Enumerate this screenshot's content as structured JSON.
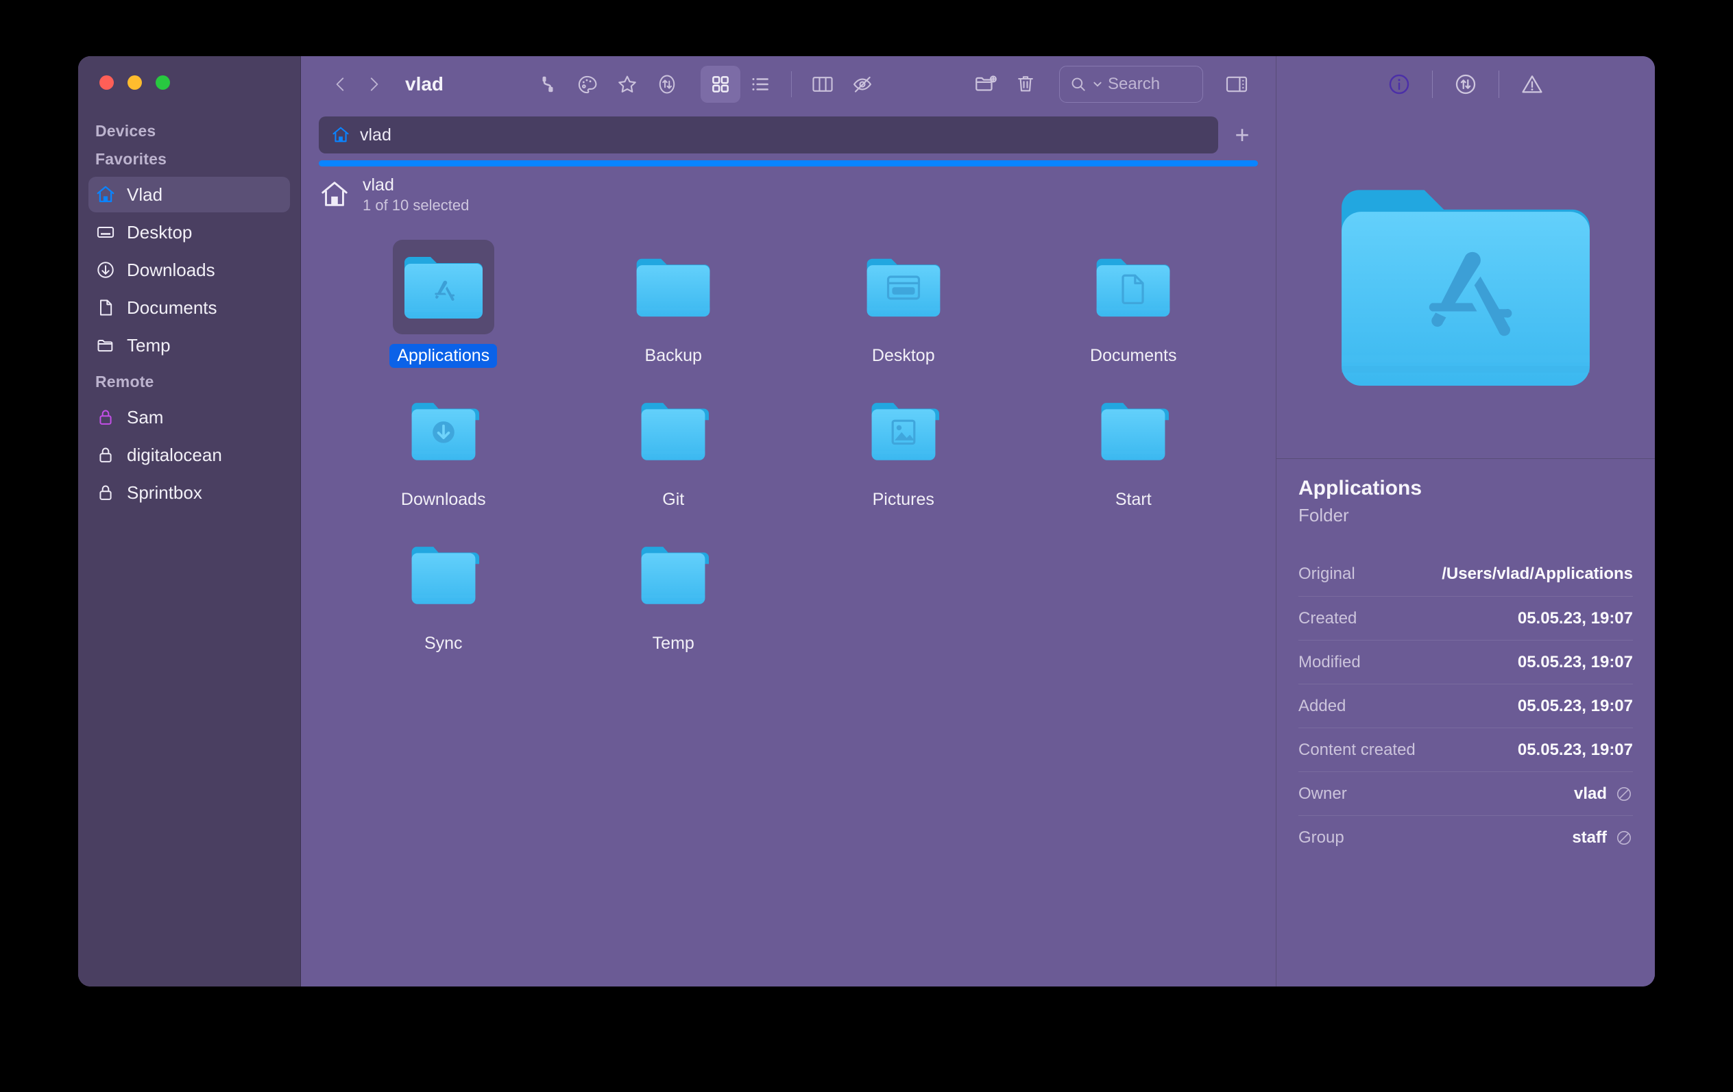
{
  "window": {
    "traffic_lights": [
      "close",
      "minimize",
      "zoom"
    ],
    "colors": {
      "window_bg": "#6B5B95",
      "sidebar_bg": "#4A3F61",
      "accent_blue": "#0A84FF",
      "selection_blue": "#0B62E8",
      "folder_blue": "#4FC3F7",
      "lock_active": "#C44FE8",
      "info_active": "#4B2FA8"
    }
  },
  "sidebar": {
    "sections": [
      {
        "title": "Devices",
        "items": []
      },
      {
        "title": "Favorites",
        "items": [
          {
            "label": "Vlad",
            "icon": "home-icon",
            "selected": true
          },
          {
            "label": "Desktop",
            "icon": "desktop-icon",
            "selected": false
          },
          {
            "label": "Downloads",
            "icon": "download-icon",
            "selected": false
          },
          {
            "label": "Documents",
            "icon": "document-icon",
            "selected": false
          },
          {
            "label": "Temp",
            "icon": "folder-icon",
            "selected": false
          }
        ]
      },
      {
        "title": "Remote",
        "items": [
          {
            "label": "Sam",
            "icon": "lock-icon",
            "selected": false
          },
          {
            "label": "digitalocean",
            "icon": "lock-icon",
            "selected": false
          },
          {
            "label": "Sprintbox",
            "icon": "lock-icon",
            "selected": false
          }
        ]
      }
    ]
  },
  "toolbar": {
    "back": "back-arrow",
    "forward": "forward-arrow",
    "breadcrumb": "vlad",
    "buttons": [
      {
        "name": "connection-icon",
        "active": false
      },
      {
        "name": "palette-icon",
        "active": false
      },
      {
        "name": "star-icon",
        "active": false
      },
      {
        "name": "sort-icon",
        "active": false
      }
    ],
    "view_modes": [
      {
        "name": "grid-view",
        "active": true
      },
      {
        "name": "list-view",
        "active": false
      },
      {
        "name": "column-view",
        "active": false
      }
    ],
    "hidden_files": "eye-slash-icon",
    "new_folder": "new-folder-icon",
    "trash": "trash-icon",
    "sidebar_toggle": "inspector-toggle-icon"
  },
  "search": {
    "placeholder": "Search",
    "value": "",
    "icon": "search-icon"
  },
  "tabs": {
    "items": [
      {
        "label": "vlad",
        "icon": "home-icon",
        "active": true
      }
    ],
    "add_label": "+"
  },
  "progress": {
    "percent": 100
  },
  "location": {
    "title": "vlad",
    "subtitle": "1 of 10 selected",
    "icon": "home-icon"
  },
  "files": [
    {
      "name": "Applications",
      "kind": "folder",
      "badge": "appstore-icon",
      "selected": true
    },
    {
      "name": "Backup",
      "kind": "folder",
      "badge": "",
      "selected": false
    },
    {
      "name": "Desktop",
      "kind": "folder",
      "badge": "desktop-icon",
      "selected": false
    },
    {
      "name": "Documents",
      "kind": "folder",
      "badge": "document-icon",
      "selected": false
    },
    {
      "name": "Downloads",
      "kind": "folder",
      "badge": "download-icon",
      "selected": false
    },
    {
      "name": "Git",
      "kind": "folder",
      "badge": "",
      "selected": false
    },
    {
      "name": "Pictures",
      "kind": "folder",
      "badge": "picture-icon",
      "selected": false
    },
    {
      "name": "Start",
      "kind": "folder",
      "badge": "",
      "selected": false
    },
    {
      "name": "Sync",
      "kind": "folder",
      "badge": "",
      "selected": false
    },
    {
      "name": "Temp",
      "kind": "folder",
      "badge": "",
      "selected": false
    }
  ],
  "inspector": {
    "tabs": [
      {
        "name": "info-icon",
        "active": true
      },
      {
        "name": "transfers-icon",
        "active": false
      },
      {
        "name": "warnings-icon",
        "active": false
      }
    ],
    "preview_icon": "applications-folder-icon",
    "title": "Applications",
    "kind": "Folder",
    "rows": [
      {
        "key": "Original",
        "value": "/Users/vlad/Applications",
        "noedit": false
      },
      {
        "key": "Created",
        "value": "05.05.23, 19:07",
        "noedit": false
      },
      {
        "key": "Modified",
        "value": "05.05.23, 19:07",
        "noedit": false
      },
      {
        "key": "Added",
        "value": "05.05.23, 19:07",
        "noedit": false
      },
      {
        "key": "Content created",
        "value": "05.05.23, 19:07",
        "noedit": false
      },
      {
        "key": "Owner",
        "value": "vlad",
        "noedit": true
      },
      {
        "key": "Group",
        "value": "staff",
        "noedit": true
      }
    ]
  }
}
